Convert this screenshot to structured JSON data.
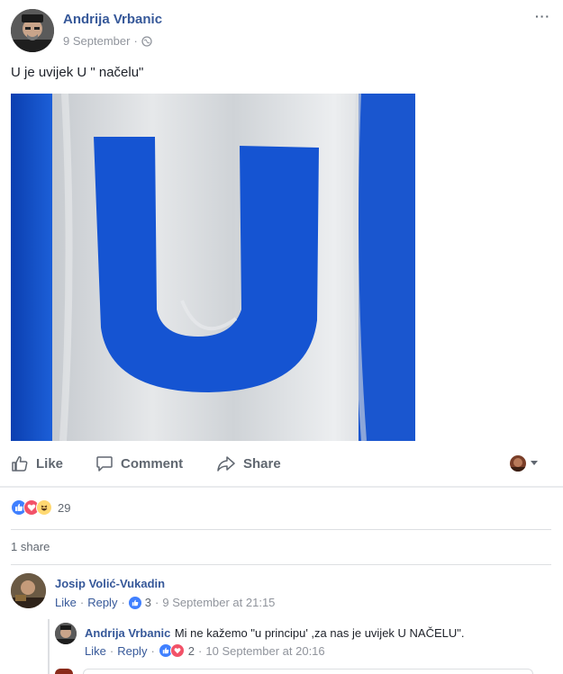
{
  "post": {
    "author": "Andrija Vrbanic",
    "date": "9 September",
    "separator": "·",
    "text": "U je uvijek U \" načelu\"",
    "more_label": "···"
  },
  "actions": {
    "like": "Like",
    "comment": "Comment",
    "share": "Share"
  },
  "reactions": {
    "count": "29",
    "types": [
      "like-icon",
      "love-icon",
      "haha-icon"
    ]
  },
  "shares": {
    "label": "1 share"
  },
  "comments": [
    {
      "author": "Josip Volić-Vukadin",
      "like": "Like",
      "reply": "Reply",
      "reaction_count": "3",
      "timestamp": "9 September at 21:15",
      "replies": [
        {
          "author": "Andrija Vrbanic",
          "text": "Mi ne kažemo \"u principu' ,za nas je uvijek U NAČELU\".",
          "like": "Like",
          "reply": "Reply",
          "reaction_count": "2",
          "timestamp": "10 September at 20:16"
        }
      ]
    }
  ],
  "colors": {
    "fb_blue": "#365899",
    "meta_gray": "#90949c",
    "flag_blue": "#1552c9",
    "like_blue": "#4080ff",
    "love_red": "#f25268",
    "haha_yellow": "#ffd972"
  }
}
